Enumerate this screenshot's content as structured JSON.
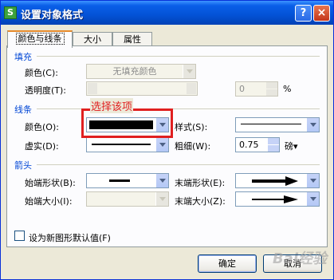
{
  "window": {
    "title": "设置对象格式",
    "app_icon_glyph": "S",
    "help_glyph": "?",
    "close_glyph": "×"
  },
  "tabs": [
    {
      "label": "颜色与线条",
      "active": true
    },
    {
      "label": "大小",
      "active": false
    },
    {
      "label": "属性",
      "active": false
    }
  ],
  "fill": {
    "section_title": "填充",
    "color_label": "颜色(C):",
    "color_value": "无填充颜色",
    "transparency_label": "透明度(T):",
    "transparency_value": "0",
    "transparency_unit": "%"
  },
  "line": {
    "section_title": "线条",
    "color_label": "颜色(O):",
    "color_value": "#000000",
    "style_label": "样式(S):",
    "dash_label": "虚实(D):",
    "weight_label": "粗细(W):",
    "weight_value": "0.75",
    "weight_unit": "磅▾"
  },
  "arrows": {
    "section_title": "箭头",
    "begin_style_label": "始端形状(B):",
    "end_style_label": "末端形状(E):",
    "begin_size_label": "始端大小(I):",
    "end_size_label": "末端大小(Z):"
  },
  "default_checkbox_label": "设为新图形默认值(F)",
  "annotation": {
    "label": "选择该项",
    "color": "#e02020"
  },
  "buttons": {
    "ok": "确定",
    "cancel": "取消"
  },
  "watermark": "Bai经验"
}
